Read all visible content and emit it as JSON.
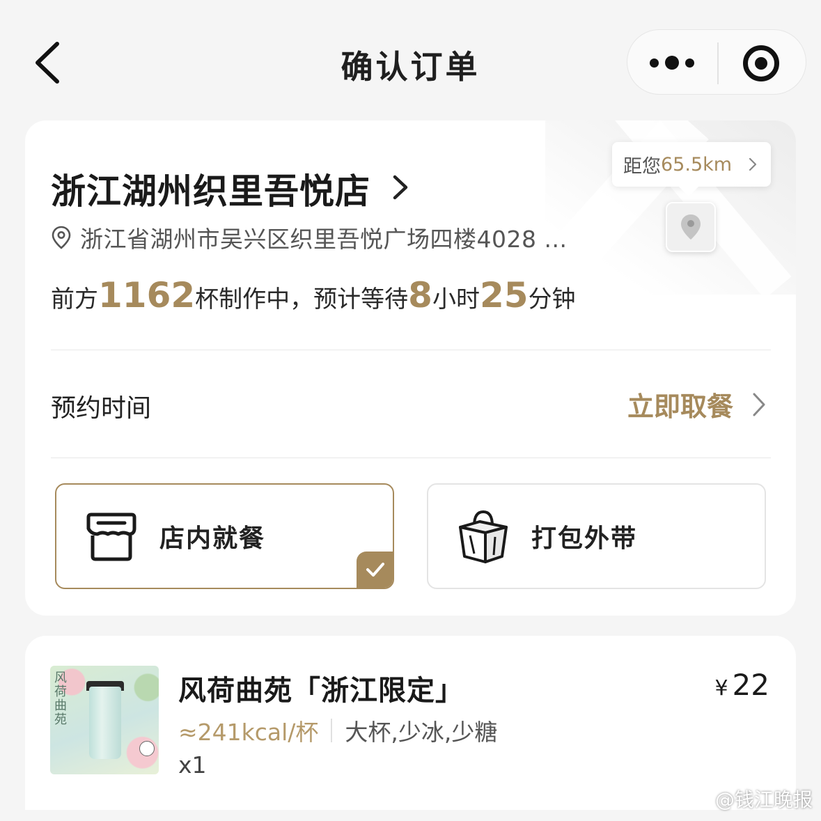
{
  "nav": {
    "title": "确认订单"
  },
  "store": {
    "name": "浙江湖州织里吾悦店",
    "address": "浙江省湖州市吴兴区织里吾悦广场四楼4028 ...",
    "distance_prefix": "距您",
    "distance_value": "65.5km"
  },
  "queue": {
    "part1": "前方",
    "cups": "1162",
    "part2": "杯制作中，预计等待",
    "hours": "8",
    "part3": "小时",
    "minutes": "25",
    "part4": "分钟"
  },
  "reservation": {
    "label": "预约时间",
    "value": "立即取餐"
  },
  "options": {
    "dine_in": "店内就餐",
    "takeaway": "打包外带",
    "selected": "dine_in"
  },
  "item": {
    "thumb_text": "风荷曲苑",
    "name": "风荷曲苑「浙江限定」",
    "currency": "¥",
    "price": "22",
    "kcal": "≈241kcal/杯",
    "spec": "大杯,少冰,少糖",
    "qty": "x1"
  },
  "watermark": "@钱江晚报",
  "colors": {
    "accent": "#a68a5c",
    "background": "#f5f5f5",
    "card": "#ffffff"
  }
}
